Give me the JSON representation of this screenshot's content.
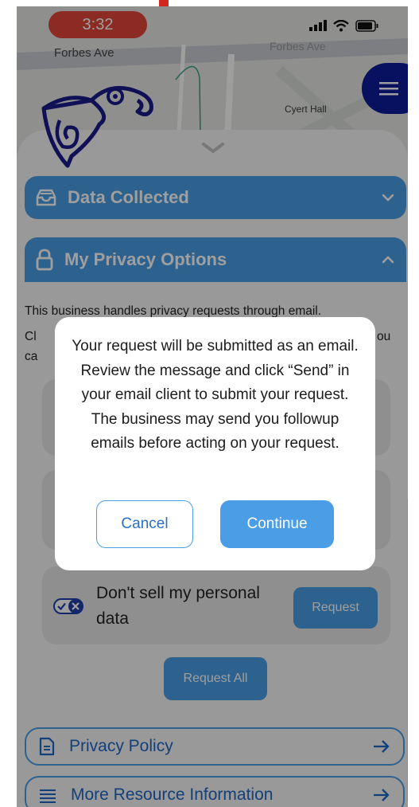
{
  "status_bar": {
    "time": "3:32"
  },
  "map": {
    "street_top": "Forbes Ave",
    "street_faded": "Forbes Ave",
    "building_label": "Cyert Hall"
  },
  "menu_button": {
    "icon": "hamburger-icon"
  },
  "sections": {
    "data_collected": {
      "label": "Data Collected",
      "icon": "inbox-tray-icon",
      "state": "collapsed"
    },
    "privacy_options": {
      "label": "My Privacy Options",
      "icon": "lock-icon",
      "state": "expanded"
    }
  },
  "privacy_body": {
    "line1": "This business handles privacy requests through email.",
    "line2_start": "Cl",
    "line2_end": "ou",
    "line3_start": "ca"
  },
  "requests": [
    {
      "label": "Don't sell my personal data",
      "button": "Request",
      "icon": "do-not-sell-toggle-icon"
    }
  ],
  "request_all_label": "Request All",
  "links": [
    {
      "label": "Privacy Policy",
      "icon": "document-icon",
      "action_icon": "arrow-right-icon"
    },
    {
      "label": "More Resource Information",
      "icon": "list-icon",
      "action_icon": "arrow-right-icon"
    }
  ],
  "modal": {
    "message": "Your request will be submitted as an email. Review the message and click “Send” in your email client to submit your request. The business may send you followup emails before acting on your request.",
    "cancel_label": "Cancel",
    "continue_label": "Continue"
  },
  "colors": {
    "accent": "#4b9ee6",
    "menu_fab": "#0d1b9c",
    "status_pill": "#e0463a",
    "logo": "#1a1a8c"
  }
}
